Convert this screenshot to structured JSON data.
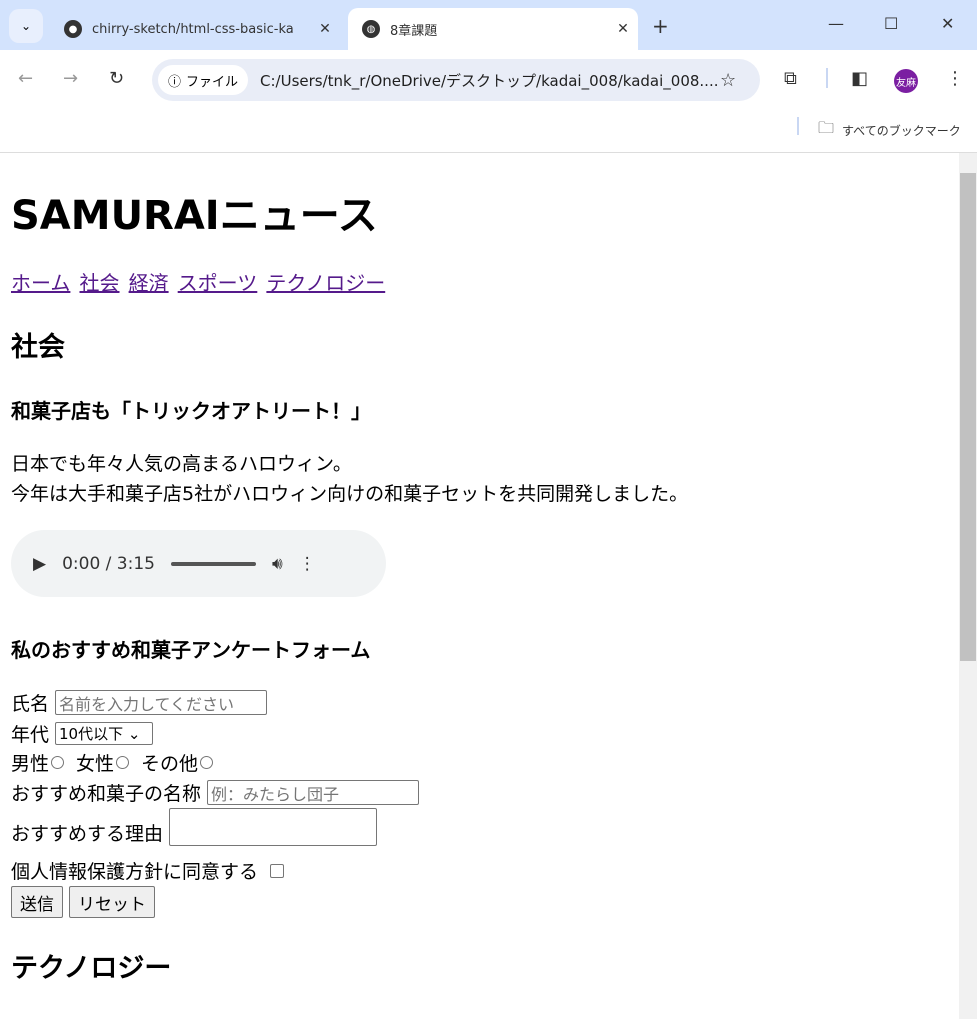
{
  "browser": {
    "tabs": [
      {
        "title": "chirry-sketch/html-css-basic-ka",
        "icon": "github-icon"
      },
      {
        "title": "8章課題",
        "icon": "globe-icon"
      }
    ],
    "security_chip": "ファイル",
    "url": "C:/Users/tnk_r/OneDrive/デスクトップ/kadai_008/kadai_008....",
    "avatar": "友麻",
    "bookmarks_label": "すべてのブックマーク"
  },
  "page": {
    "title": "SAMURAIニュース",
    "nav": [
      "ホーム",
      "社会",
      "経済",
      "スポーツ",
      "テクノロジー"
    ],
    "section": "社会",
    "article_title": "和菓子店も「トリックオアトリート！」",
    "paragraph": [
      "日本でも年々人気の高まるハロウィン。",
      "今年は大手和菓子店5社がハロウィン向けの和菓子セットを共同開発しました。"
    ],
    "audio": {
      "time": "0:00 / 3:15",
      "progress": 0
    },
    "form": {
      "title": "私のおすすめ和菓子アンケートフォーム",
      "name_label": "氏名",
      "name_placeholder": "名前を入力してください",
      "age_label": "年代",
      "age_value": "10代以下",
      "genders": [
        "男性",
        "女性",
        "その他"
      ],
      "sweet_label": "おすすめ和菓子の名称",
      "sweet_placeholder": "例：みたらし団子",
      "reason_label": "おすすめする理由",
      "agree_label": "個人情報保護方針に同意する",
      "submit": "送信",
      "reset": "リセット"
    },
    "next_section": "テクノロジー"
  }
}
